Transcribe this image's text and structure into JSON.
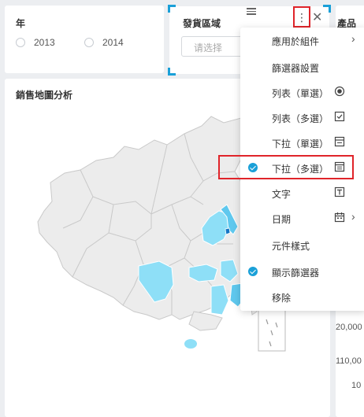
{
  "year_filter": {
    "title": "年",
    "options": [
      "2013",
      "2014"
    ]
  },
  "area_filter": {
    "title": "發貨區域",
    "placeholder": "请选择",
    "icons": [
      "drag-handle-icon",
      "more-vertical-icon",
      "close-icon"
    ]
  },
  "product_card": {
    "title_fragment": "產品",
    "axis_values": [
      "20,000",
      "110,00",
      "10"
    ]
  },
  "map": {
    "title": "銷售地圖分析",
    "highlight_color": "#8edff7",
    "base_color": "#ececec",
    "accent_color": "#1aa0d8"
  },
  "menu": {
    "items": [
      {
        "label": "應用於組件",
        "checked": false,
        "icon": "",
        "submenu": true
      },
      {
        "label": "篩選器設置",
        "checked": false,
        "icon": "",
        "submenu": false
      },
      {
        "label": "列表（單選）",
        "checked": false,
        "icon": "radio-icon",
        "submenu": false
      },
      {
        "label": "列表（多選）",
        "checked": false,
        "icon": "checkbox-icon",
        "submenu": false
      },
      {
        "label": "下拉（單選）",
        "checked": false,
        "icon": "dropdown-icon",
        "submenu": false
      },
      {
        "label": "下拉（多選）",
        "checked": true,
        "icon": "dropdown-multi-icon",
        "submenu": false
      },
      {
        "label": "文字",
        "checked": false,
        "icon": "text-icon",
        "submenu": false
      },
      {
        "label": "日期",
        "checked": false,
        "icon": "calendar-icon",
        "submenu": true
      },
      {
        "label": "元件樣式",
        "checked": false,
        "icon": "",
        "submenu": false
      },
      {
        "label": "顯示篩選器",
        "checked": true,
        "icon": "",
        "submenu": false
      },
      {
        "label": "移除",
        "checked": false,
        "icon": "",
        "submenu": false
      }
    ]
  }
}
